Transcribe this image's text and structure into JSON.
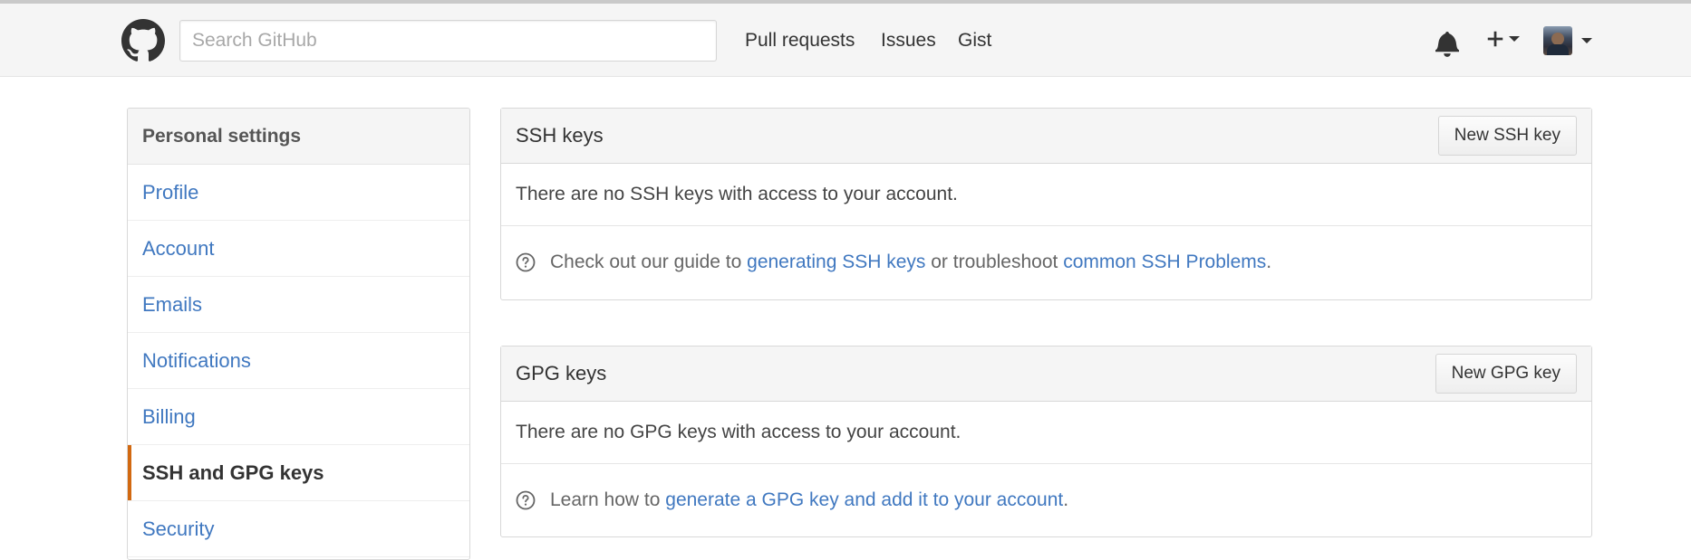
{
  "header": {
    "search_placeholder": "Search GitHub",
    "nav": {
      "pull_requests": "Pull requests",
      "issues": "Issues",
      "gist": "Gist"
    }
  },
  "sidebar": {
    "heading": "Personal settings",
    "items": [
      {
        "label": "Profile"
      },
      {
        "label": "Account"
      },
      {
        "label": "Emails"
      },
      {
        "label": "Notifications"
      },
      {
        "label": "Billing"
      },
      {
        "label": "SSH and GPG keys",
        "selected": true
      },
      {
        "label": "Security"
      }
    ]
  },
  "ssh": {
    "title": "SSH keys",
    "button": "New SSH key",
    "empty": "There are no SSH keys with access to your account.",
    "help_prefix": "Check out our guide to ",
    "help_link1": "generating SSH keys",
    "help_middle": " or troubleshoot ",
    "help_link2": "common SSH Problems",
    "help_suffix": "."
  },
  "gpg": {
    "title": "GPG keys",
    "button": "New GPG key",
    "empty": "There are no GPG keys with access to your account.",
    "help_prefix": "Learn how to ",
    "help_link": "generate a GPG key and add it to your account",
    "help_suffix": "."
  },
  "colors": {
    "link": "#4078c0",
    "selected_accent": "#d26911",
    "header_bg": "#f5f5f5"
  },
  "icons": [
    "github-logo-icon",
    "bell-icon",
    "plus-icon",
    "avatar",
    "question-icon"
  ]
}
